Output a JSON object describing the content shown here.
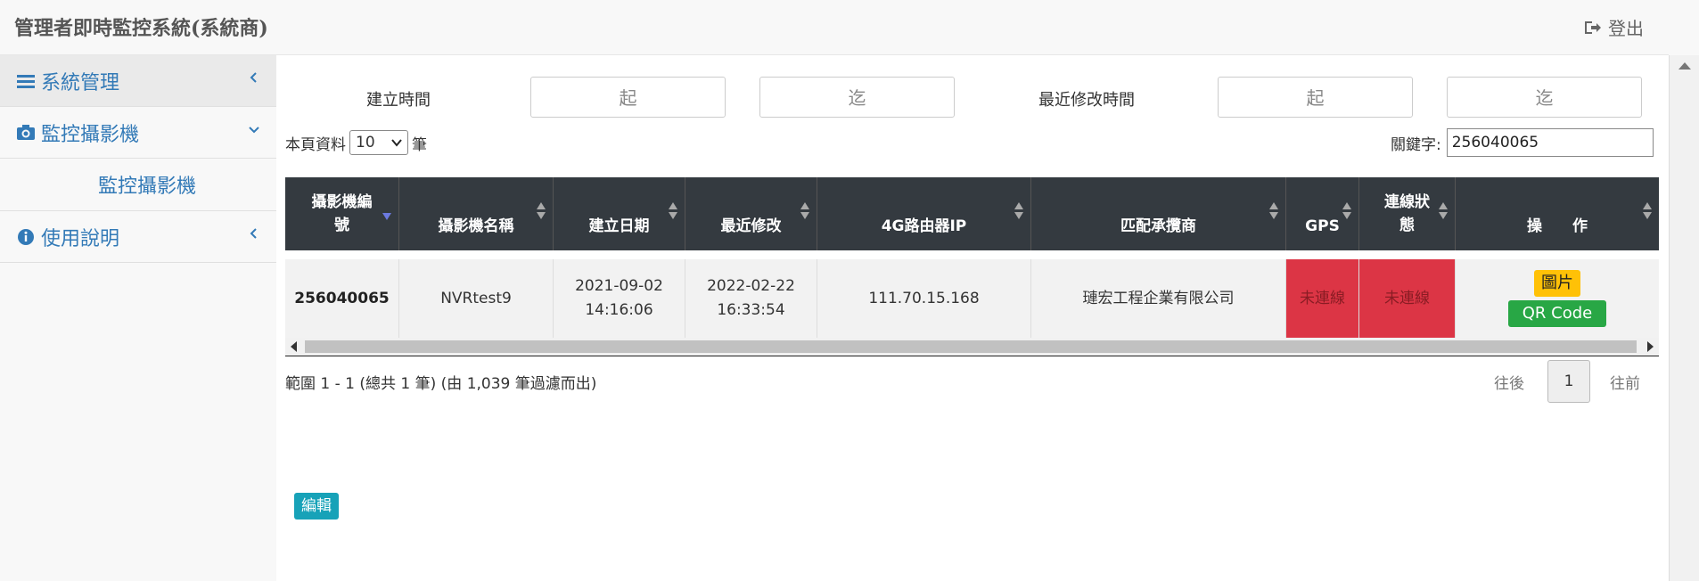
{
  "app": {
    "title": "管理者即時監控系統(系統商)",
    "logout": "登出"
  },
  "sidebar": {
    "items": [
      {
        "label": "系統管理",
        "icon": "bars-icon"
      },
      {
        "label": "監控攝影機",
        "icon": "camera-icon"
      },
      {
        "label": "監控攝影機"
      },
      {
        "label": "使用說明",
        "icon": "info-circle-icon"
      }
    ]
  },
  "filters": {
    "created_label": "建立時間",
    "modified_label": "最近修改時間",
    "from_placeholder": "起",
    "to_placeholder": "迄"
  },
  "list": {
    "per_page_prefix": "本頁資料",
    "per_page_value": "10",
    "per_page_suffix": "筆",
    "keyword_label": "關鍵字:",
    "keyword_value": "256040065"
  },
  "table": {
    "headers": [
      "攝影機編號",
      "攝影機名稱",
      "建立日期",
      "最近修改",
      "4G路由器IP",
      "匹配承攬商",
      "GPS",
      "連線狀態",
      "操　　作"
    ],
    "rows": [
      {
        "id": "256040065",
        "name": "NVRtest9",
        "created_date": "2021-09-02",
        "created_time": "14:16:06",
        "modified_date": "2022-02-22",
        "modified_time": "16:33:54",
        "ip": "111.70.15.168",
        "contractor": "璉宏工程企業有限公司",
        "gps": "未連線",
        "status": "未連線",
        "actions": {
          "edit": "編輯",
          "image": "圖片",
          "qr": "QR Code"
        }
      }
    ]
  },
  "footer": {
    "info": "範圍 1 - 1 (總共 1 筆) (由 1,039 筆過濾而出)",
    "prev": "往後",
    "page": "1",
    "next": "往前"
  }
}
